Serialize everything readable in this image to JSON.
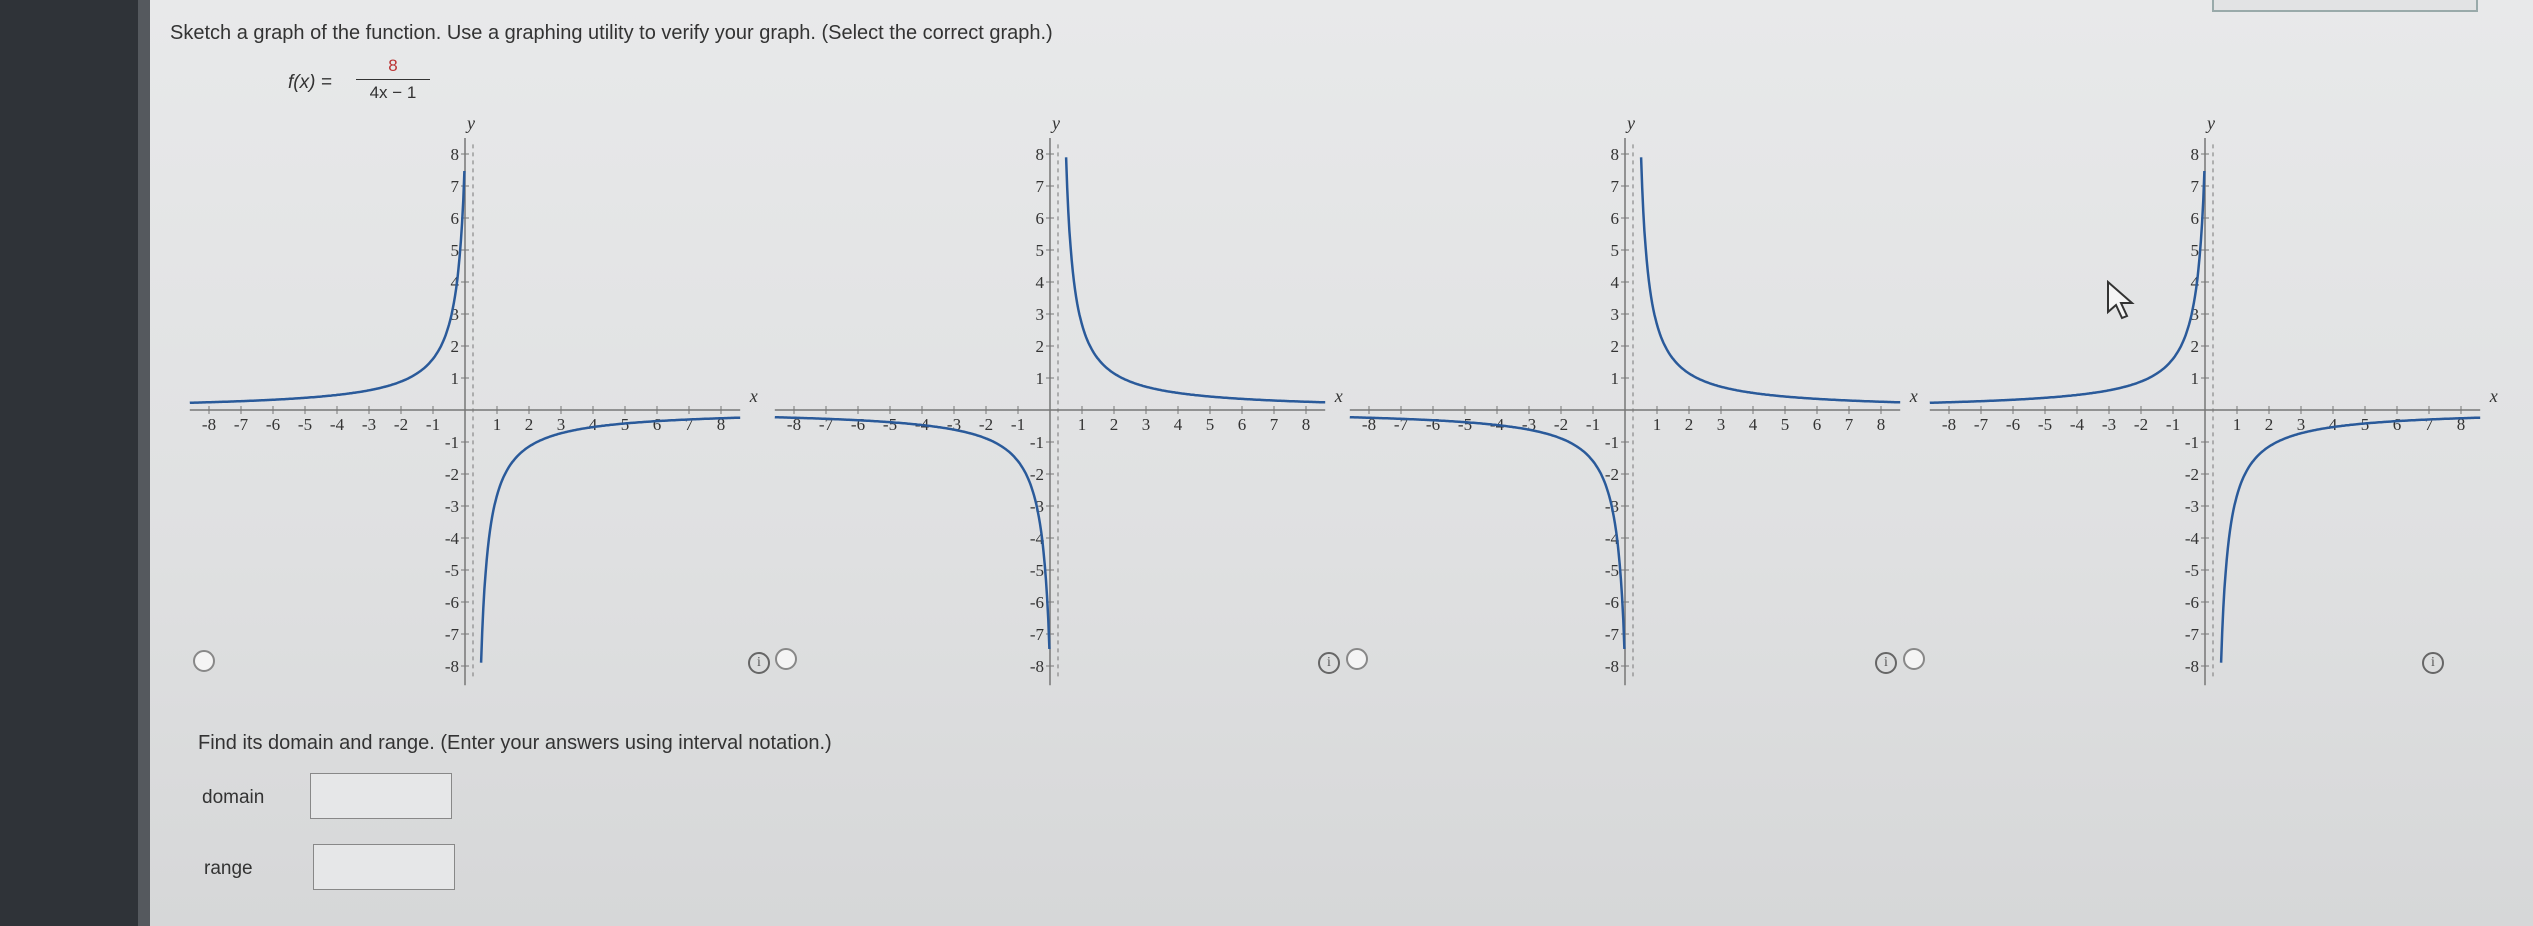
{
  "question": "Sketch a graph of the function. Use a graphing utility to verify your graph. (Select the correct graph.)",
  "function": {
    "lhs": "f(x) =",
    "numerator": "8",
    "denominator": "4x − 1"
  },
  "axes": {
    "x_label": "x",
    "y_label": "y",
    "ticks": [
      -8,
      -7,
      -6,
      -5,
      -4,
      -3,
      -2,
      -1,
      1,
      2,
      3,
      4,
      5,
      6,
      7,
      8
    ]
  },
  "colors": {
    "curve": "#2a5a9a",
    "grid": "#777777"
  },
  "options": [
    {
      "id": "a",
      "asymptote": 0.25,
      "sign": -1,
      "selected": false
    },
    {
      "id": "b",
      "asymptote": 0.25,
      "sign": 1,
      "selected": false
    },
    {
      "id": "c",
      "asymptote": 0.25,
      "sign": 1,
      "selected": false
    },
    {
      "id": "d",
      "asymptote": 0.25,
      "sign": -1,
      "selected": false
    }
  ],
  "info_icon": "info-icon",
  "domain_range_prompt": "Find its domain and range. (Enter your answers using interval notation.)",
  "domain": {
    "label": "domain",
    "value": ""
  },
  "range": {
    "label": "range",
    "value": ""
  }
}
